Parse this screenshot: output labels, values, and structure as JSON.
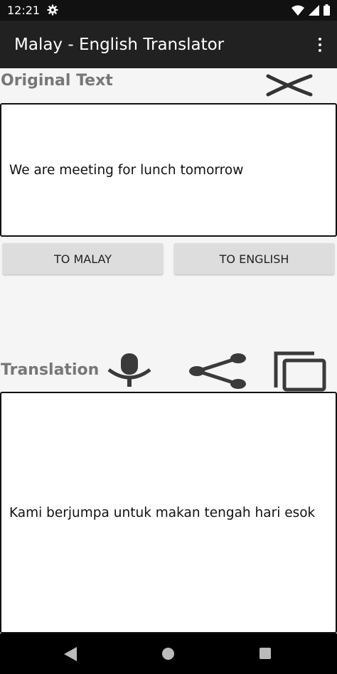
{
  "status_bar": {
    "time": "12:21"
  },
  "app_bar": {
    "title": "Malay - English Translator"
  },
  "original": {
    "label": "Original Text",
    "text": "We are meeting for lunch tomorrow"
  },
  "buttons": {
    "to_malay": "TO MALAY",
    "to_english": "TO ENGLISH"
  },
  "translation": {
    "label": "Translation",
    "text": "Kami berjumpa untuk makan tengah hari esok"
  },
  "icons": {
    "clear": "close-icon",
    "speak": "microphone-icon",
    "share": "share-icon",
    "copy": "copy-icon"
  },
  "colors": {
    "app_bar": "#212121",
    "label_gray": "#777777",
    "button_bg": "#dddddd"
  }
}
